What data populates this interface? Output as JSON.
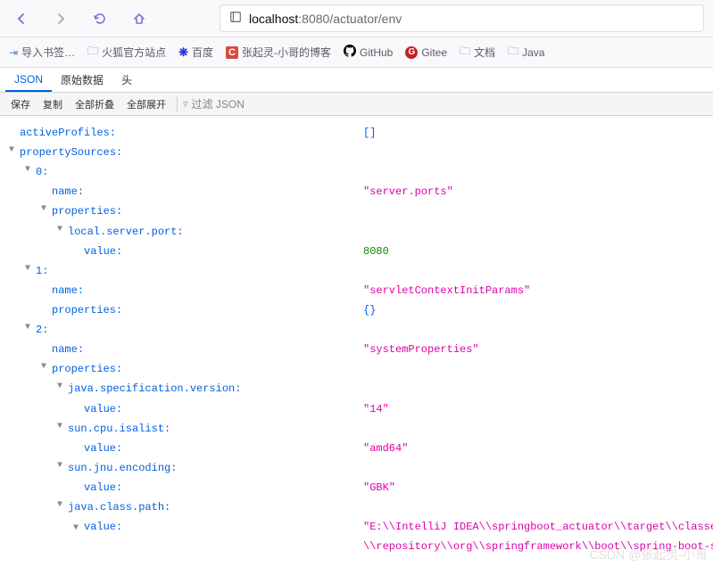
{
  "url": {
    "host": "localhost",
    "port": ":8080",
    "path": "/actuator/env"
  },
  "bookmarks": {
    "import": "导入书签…",
    "firefox": "火狐官方站点",
    "baidu": "百度",
    "csdn": "张起灵-小哥的博客",
    "github": "GitHub",
    "gitee": "Gitee",
    "docs": "文档",
    "java": "Java"
  },
  "tabs": {
    "json": "JSON",
    "raw": "原始数据",
    "headers": "头"
  },
  "toolbar": {
    "save": "保存",
    "copy": "复制",
    "collapse": "全部折叠",
    "expand": "全部展开",
    "filter": "过滤 JSON"
  },
  "tree": {
    "activeProfiles": {
      "k": "activeProfiles",
      "v": "[]"
    },
    "propertySources": {
      "k": "propertySources"
    },
    "ps0": {
      "idx": "0",
      "name_k": "name",
      "name_v": "\"server.ports\"",
      "props_k": "properties",
      "local_port_k": "local.server.port",
      "value_k": "value",
      "value_v": "8080"
    },
    "ps1": {
      "idx": "1",
      "name_k": "name",
      "name_v": "\"servletContextInitParams\"",
      "props_k": "properties",
      "props_v": "{}"
    },
    "ps2": {
      "idx": "2",
      "name_k": "name",
      "name_v": "\"systemProperties\"",
      "props_k": "properties",
      "jsv_k": "java.specification.version",
      "jsv_v": "\"14\"",
      "cpu_k": "sun.cpu.isalist",
      "cpu_v": "\"amd64\"",
      "enc_k": "sun.jnu.encoding",
      "enc_v": "\"GBK\"",
      "jcp_k": "java.class.path",
      "jcp_v": "\"E:\\\\IntelliJ IDEA\\\\springboot_actuator\\\\target\\\\classes;C",
      "jcp_v2": "\\\\repository\\\\org\\\\springframework\\\\boot\\\\spring-boot-star",
      "value_k": "value"
    }
  },
  "watermark": "CSDN @张起灵-小哥"
}
